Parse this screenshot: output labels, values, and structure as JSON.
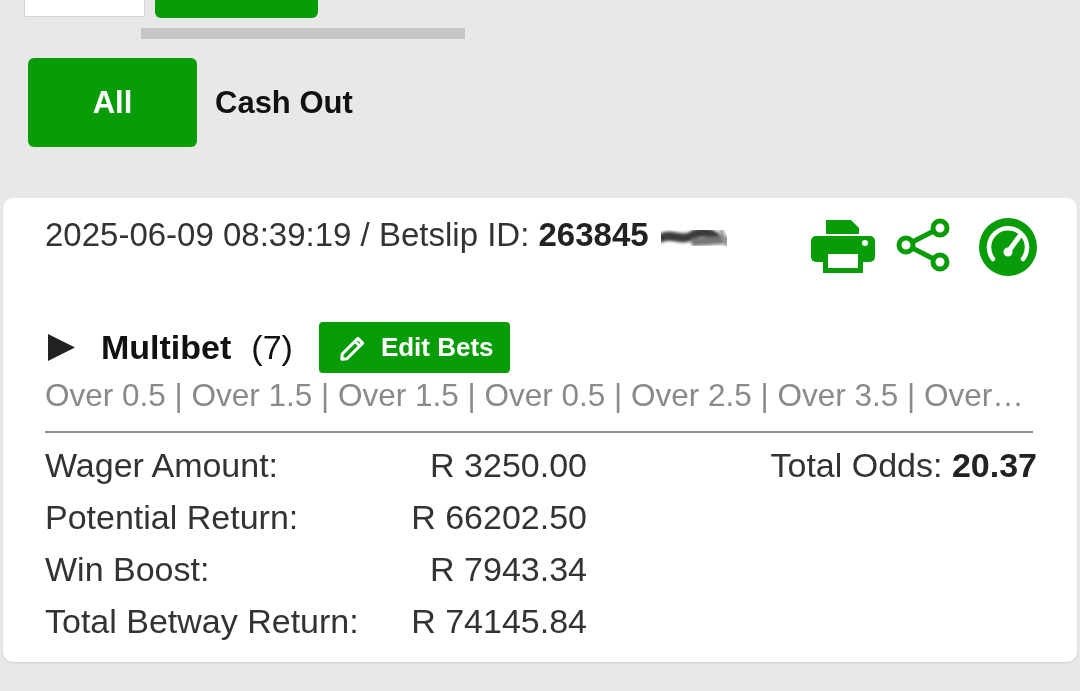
{
  "filter_tabs": [
    {
      "label": "All",
      "selected": true
    },
    {
      "label": "Cash Out",
      "selected": false
    }
  ],
  "betslip": {
    "info": "2025-06-09 08:39:19 / Betslip ID: **263845**",
    "bet": {
      "expanded": false,
      "title": "Multibet",
      "count": "(7)",
      "edit_button": "Edit Bets",
      "selections": "Over 0.5 | Over 1.5 | Over 1.5 | Over 0.5 | Over 2.5 | Over 3.5 | Over…"
    },
    "summary": [
      {
        "label": "Wager Amount:",
        "value": "R 3250.00"
      },
      {
        "label": "Potential Return:",
        "value": "R 66202.50"
      },
      {
        "label": "Win Boost:",
        "value": "R 7943.34"
      },
      {
        "label": "Total Betway Return:",
        "value": "R 74145.84"
      }
    ],
    "total_odds": "Total Odds: **20.37**"
  }
}
